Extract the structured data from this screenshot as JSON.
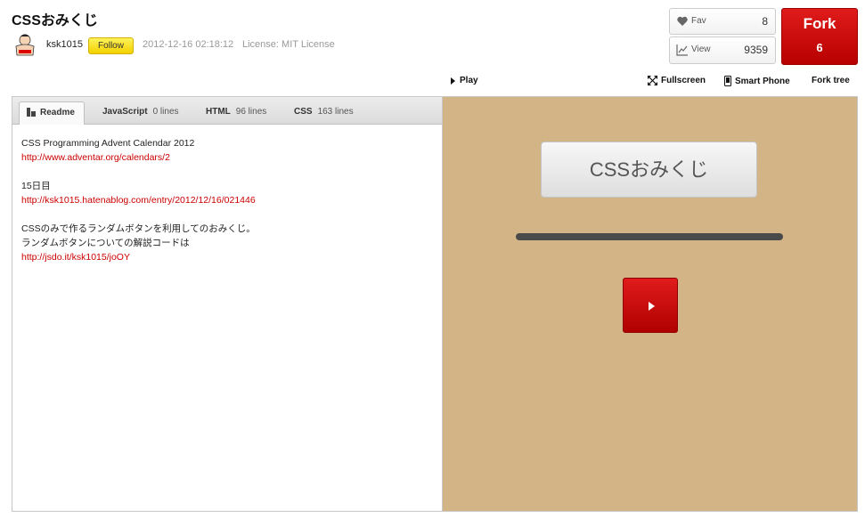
{
  "header": {
    "title": "CSSおみくじ",
    "username": "ksk1015",
    "follow_label": "Follow",
    "date": "2012-12-16 02:18:12",
    "license": "License: MIT License"
  },
  "stats": {
    "fav_label": "Fav",
    "fav_count": "8",
    "view_label": "View",
    "view_count": "9359",
    "fork_label": "Fork",
    "fork_count": "6"
  },
  "toolbar": {
    "play": "Play",
    "fullscreen": "Fullscreen",
    "smartphone": "Smart Phone",
    "forktree": "Fork tree"
  },
  "tabs": {
    "readme": "Readme",
    "js": "JavaScript",
    "js_lines": "0 lines",
    "html": "HTML",
    "html_lines": "96 lines",
    "css": "CSS",
    "css_lines": "163 lines"
  },
  "readme": {
    "line1": "CSS Programming Advent Calendar 2012",
    "link1": "http://www.adventar.org/calendars/2",
    "line2": "15日目",
    "link2": "http://ksk1015.hatenablog.com/entry/2012/12/16/021446",
    "line3": "CSSのみで作るランダムボタンを利用してのおみくじ。",
    "line4": "ランダムボタンについての解説コードは",
    "link3": "http://jsdo.it/ksk1015/joOY"
  },
  "preview": {
    "omikuji_label": "CSSおみくじ"
  },
  "colors": {
    "accent_red": "#c00000",
    "preview_bg": "#d2b487",
    "follow_yellow": "#f2d100"
  }
}
